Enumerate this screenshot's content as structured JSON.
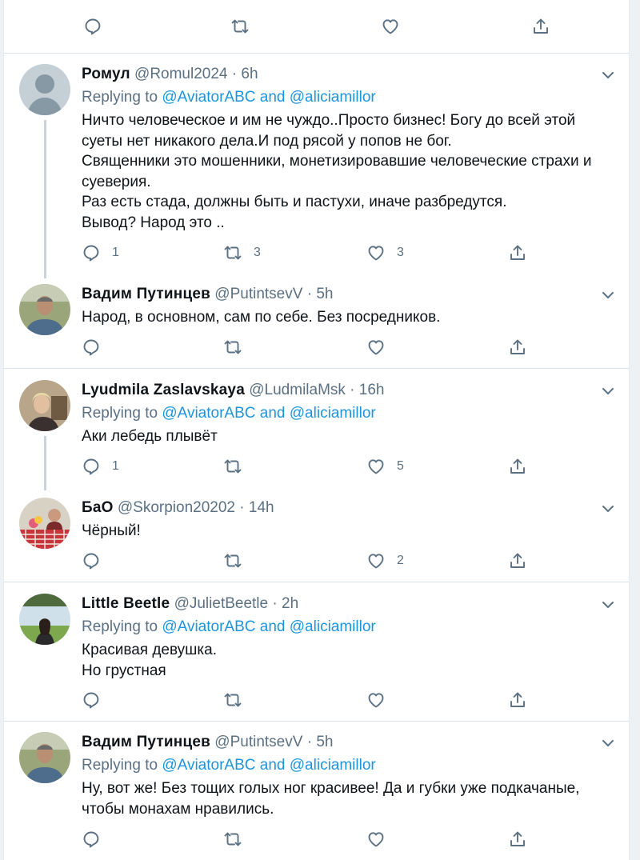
{
  "replying_label": "Replying to",
  "and_label": "and",
  "top_actions": {
    "reply": "",
    "retweet": "",
    "like": ""
  },
  "tweets": [
    {
      "name": "Ромул",
      "handle": "@Romul2024",
      "time": "6h",
      "replying_to": [
        "@AviatorABC",
        "@aliciamillor"
      ],
      "text": [
        "Ничто человеческое и им не чуждо..Просто бизнес! Богу до всей этой суеты нет никакого дела.И под рясой у попов не бог.",
        "Священники это мошенники, монетизировавшие человеческие страхи и суеверия.",
        "Раз есть стада, должны быть и пастухи, иначе разбредутся.",
        "Вывод? Народ это .."
      ],
      "replies": "1",
      "retweets": "3",
      "likes": "3"
    },
    {
      "name": "Вадим Путинцев",
      "handle": "@PutintsevV",
      "time": "5h",
      "text": [
        "Народ, в основном, сам по себе. Без посредников."
      ],
      "replies": "",
      "retweets": "",
      "likes": ""
    },
    {
      "name": "Lyudmila Zaslavskaya",
      "handle": "@LudmilaMsk",
      "time": "16h",
      "replying_to": [
        "@AviatorABC",
        "@aliciamillor"
      ],
      "text": [
        "Аки лебедь плывёт"
      ],
      "replies": "1",
      "retweets": "",
      "likes": "5"
    },
    {
      "name": "БаО",
      "handle": "@Skorpion20202",
      "time": "14h",
      "text": [
        "Чёрный!"
      ],
      "replies": "",
      "retweets": "",
      "likes": "2"
    },
    {
      "name": "Little Beetle",
      "handle": "@JulietBeetle",
      "time": "2h",
      "replying_to": [
        "@AviatorABC",
        "@aliciamillor"
      ],
      "text": [
        "Красивая девушка.",
        "Но грустная"
      ],
      "replies": "",
      "retweets": "",
      "likes": ""
    },
    {
      "name": "Вадим Путинцев",
      "handle": "@PutintsevV",
      "time": "5h",
      "replying_to": [
        "@AviatorABC",
        "@aliciamillor"
      ],
      "text": [
        "Ну, вот же! Без тощих голых ног красивее! Да и губки уже подкачаные, чтобы монахам нравились."
      ],
      "replies": "",
      "retweets": "",
      "likes": ""
    }
  ],
  "colors": {
    "link": "#1b95e0",
    "muted": "#5b7083",
    "text": "#0f1419",
    "thread_line": "#c8d3dc"
  }
}
